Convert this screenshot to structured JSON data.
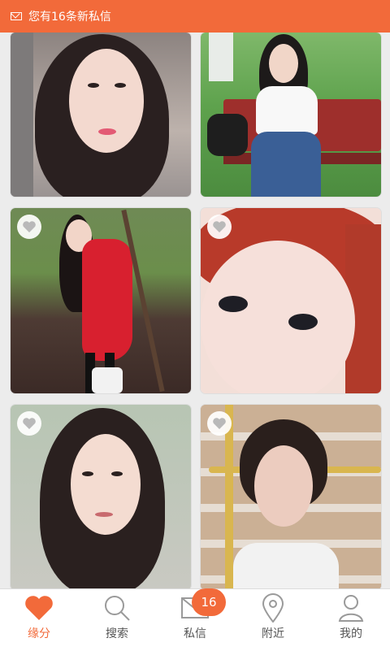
{
  "statusbar": {
    "notice": "您有16条新私信",
    "icon": "mail-icon",
    "bg": "#f26a3a"
  },
  "cards": [
    {
      "id": "profile-card-1",
      "heart": false
    },
    {
      "id": "profile-card-2",
      "heart": false
    },
    {
      "id": "profile-card-3",
      "heart": true
    },
    {
      "id": "profile-card-4",
      "heart": true
    },
    {
      "id": "profile-card-5",
      "heart": true
    },
    {
      "id": "profile-card-6",
      "heart": true
    }
  ],
  "tabs": {
    "fate": {
      "label": "缘分",
      "icon": "heart-icon",
      "active": true
    },
    "search": {
      "label": "搜索",
      "icon": "search-icon"
    },
    "messages": {
      "label": "私信",
      "icon": "mail-icon",
      "badge": "16"
    },
    "nearby": {
      "label": "附近",
      "icon": "location-pin-icon"
    },
    "me": {
      "label": "我的",
      "icon": "user-icon"
    }
  },
  "accent": "#f26a3a"
}
